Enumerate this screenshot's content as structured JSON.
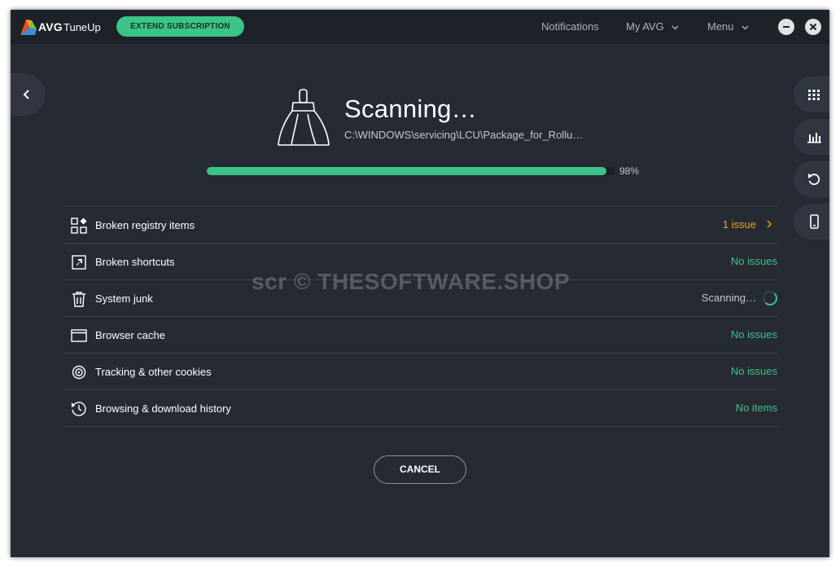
{
  "app": {
    "brand": "AVG",
    "name": "TuneUp",
    "extend_label": "EXTEND SUBSCRIPTION",
    "logo_colors": [
      "#e84a2b",
      "#f5a623",
      "#7dc242",
      "#3a8fd6"
    ]
  },
  "nav": {
    "notifications": "Notifications",
    "my_avg": "My AVG",
    "menu": "Menu"
  },
  "scan": {
    "title": "Scanning…",
    "path": "C:\\WINDOWS\\servicing\\LCU\\Package_for_Rollu…",
    "progress_percent": 98,
    "progress_label": "98%"
  },
  "items": [
    {
      "label": "Broken registry items",
      "status": "1 issue",
      "state": "issue",
      "icon": "registry-icon"
    },
    {
      "label": "Broken shortcuts",
      "status": "No issues",
      "state": "ok",
      "icon": "shortcut-icon"
    },
    {
      "label": "System junk",
      "status": "Scanning…",
      "state": "scanning",
      "icon": "trash-icon"
    },
    {
      "label": "Browser cache",
      "status": "No issues",
      "state": "ok",
      "icon": "browser-icon"
    },
    {
      "label": "Tracking & other cookies",
      "status": "No issues",
      "state": "ok",
      "icon": "target-icon"
    },
    {
      "label": "Browsing & download history",
      "status": "No items",
      "state": "ok",
      "icon": "history-icon"
    }
  ],
  "cancel_label": "CANCEL",
  "watermark": "scr © THESOFTWARE.SHOP",
  "colors": {
    "accent": "#3cc387",
    "warning": "#f0a022",
    "background": "#262b33",
    "titlebar": "#1d2128"
  }
}
